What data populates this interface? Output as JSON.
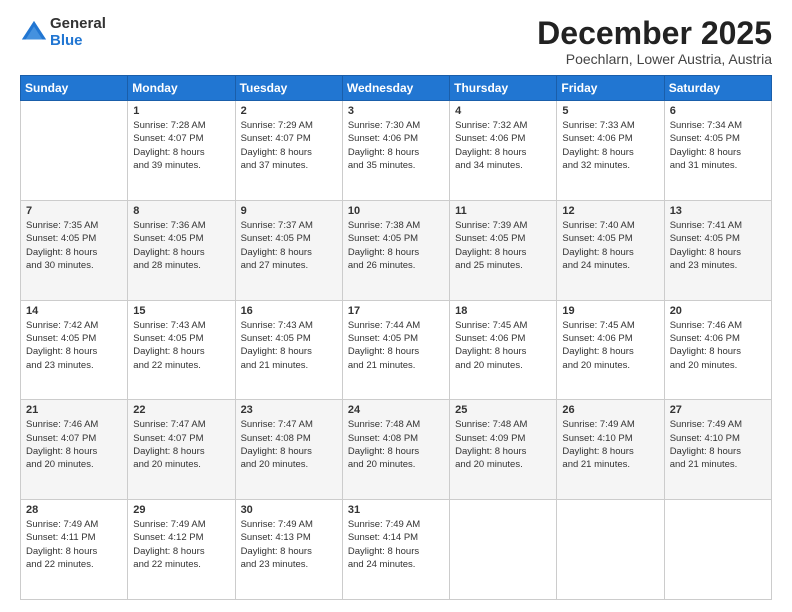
{
  "logo": {
    "general": "General",
    "blue": "Blue"
  },
  "header": {
    "month": "December 2025",
    "location": "Poechlarn, Lower Austria, Austria"
  },
  "weekdays": [
    "Sunday",
    "Monday",
    "Tuesday",
    "Wednesday",
    "Thursday",
    "Friday",
    "Saturday"
  ],
  "weeks": [
    [
      {
        "day": "",
        "info": ""
      },
      {
        "day": "1",
        "info": "Sunrise: 7:28 AM\nSunset: 4:07 PM\nDaylight: 8 hours\nand 39 minutes."
      },
      {
        "day": "2",
        "info": "Sunrise: 7:29 AM\nSunset: 4:07 PM\nDaylight: 8 hours\nand 37 minutes."
      },
      {
        "day": "3",
        "info": "Sunrise: 7:30 AM\nSunset: 4:06 PM\nDaylight: 8 hours\nand 35 minutes."
      },
      {
        "day": "4",
        "info": "Sunrise: 7:32 AM\nSunset: 4:06 PM\nDaylight: 8 hours\nand 34 minutes."
      },
      {
        "day": "5",
        "info": "Sunrise: 7:33 AM\nSunset: 4:06 PM\nDaylight: 8 hours\nand 32 minutes."
      },
      {
        "day": "6",
        "info": "Sunrise: 7:34 AM\nSunset: 4:05 PM\nDaylight: 8 hours\nand 31 minutes."
      }
    ],
    [
      {
        "day": "7",
        "info": "Sunrise: 7:35 AM\nSunset: 4:05 PM\nDaylight: 8 hours\nand 30 minutes."
      },
      {
        "day": "8",
        "info": "Sunrise: 7:36 AM\nSunset: 4:05 PM\nDaylight: 8 hours\nand 28 minutes."
      },
      {
        "day": "9",
        "info": "Sunrise: 7:37 AM\nSunset: 4:05 PM\nDaylight: 8 hours\nand 27 minutes."
      },
      {
        "day": "10",
        "info": "Sunrise: 7:38 AM\nSunset: 4:05 PM\nDaylight: 8 hours\nand 26 minutes."
      },
      {
        "day": "11",
        "info": "Sunrise: 7:39 AM\nSunset: 4:05 PM\nDaylight: 8 hours\nand 25 minutes."
      },
      {
        "day": "12",
        "info": "Sunrise: 7:40 AM\nSunset: 4:05 PM\nDaylight: 8 hours\nand 24 minutes."
      },
      {
        "day": "13",
        "info": "Sunrise: 7:41 AM\nSunset: 4:05 PM\nDaylight: 8 hours\nand 23 minutes."
      }
    ],
    [
      {
        "day": "14",
        "info": "Sunrise: 7:42 AM\nSunset: 4:05 PM\nDaylight: 8 hours\nand 23 minutes."
      },
      {
        "day": "15",
        "info": "Sunrise: 7:43 AM\nSunset: 4:05 PM\nDaylight: 8 hours\nand 22 minutes."
      },
      {
        "day": "16",
        "info": "Sunrise: 7:43 AM\nSunset: 4:05 PM\nDaylight: 8 hours\nand 21 minutes."
      },
      {
        "day": "17",
        "info": "Sunrise: 7:44 AM\nSunset: 4:05 PM\nDaylight: 8 hours\nand 21 minutes."
      },
      {
        "day": "18",
        "info": "Sunrise: 7:45 AM\nSunset: 4:06 PM\nDaylight: 8 hours\nand 20 minutes."
      },
      {
        "day": "19",
        "info": "Sunrise: 7:45 AM\nSunset: 4:06 PM\nDaylight: 8 hours\nand 20 minutes."
      },
      {
        "day": "20",
        "info": "Sunrise: 7:46 AM\nSunset: 4:06 PM\nDaylight: 8 hours\nand 20 minutes."
      }
    ],
    [
      {
        "day": "21",
        "info": "Sunrise: 7:46 AM\nSunset: 4:07 PM\nDaylight: 8 hours\nand 20 minutes."
      },
      {
        "day": "22",
        "info": "Sunrise: 7:47 AM\nSunset: 4:07 PM\nDaylight: 8 hours\nand 20 minutes."
      },
      {
        "day": "23",
        "info": "Sunrise: 7:47 AM\nSunset: 4:08 PM\nDaylight: 8 hours\nand 20 minutes."
      },
      {
        "day": "24",
        "info": "Sunrise: 7:48 AM\nSunset: 4:08 PM\nDaylight: 8 hours\nand 20 minutes."
      },
      {
        "day": "25",
        "info": "Sunrise: 7:48 AM\nSunset: 4:09 PM\nDaylight: 8 hours\nand 20 minutes."
      },
      {
        "day": "26",
        "info": "Sunrise: 7:49 AM\nSunset: 4:10 PM\nDaylight: 8 hours\nand 21 minutes."
      },
      {
        "day": "27",
        "info": "Sunrise: 7:49 AM\nSunset: 4:10 PM\nDaylight: 8 hours\nand 21 minutes."
      }
    ],
    [
      {
        "day": "28",
        "info": "Sunrise: 7:49 AM\nSunset: 4:11 PM\nDaylight: 8 hours\nand 22 minutes."
      },
      {
        "day": "29",
        "info": "Sunrise: 7:49 AM\nSunset: 4:12 PM\nDaylight: 8 hours\nand 22 minutes."
      },
      {
        "day": "30",
        "info": "Sunrise: 7:49 AM\nSunset: 4:13 PM\nDaylight: 8 hours\nand 23 minutes."
      },
      {
        "day": "31",
        "info": "Sunrise: 7:49 AM\nSunset: 4:14 PM\nDaylight: 8 hours\nand 24 minutes."
      },
      {
        "day": "",
        "info": ""
      },
      {
        "day": "",
        "info": ""
      },
      {
        "day": "",
        "info": ""
      }
    ]
  ]
}
